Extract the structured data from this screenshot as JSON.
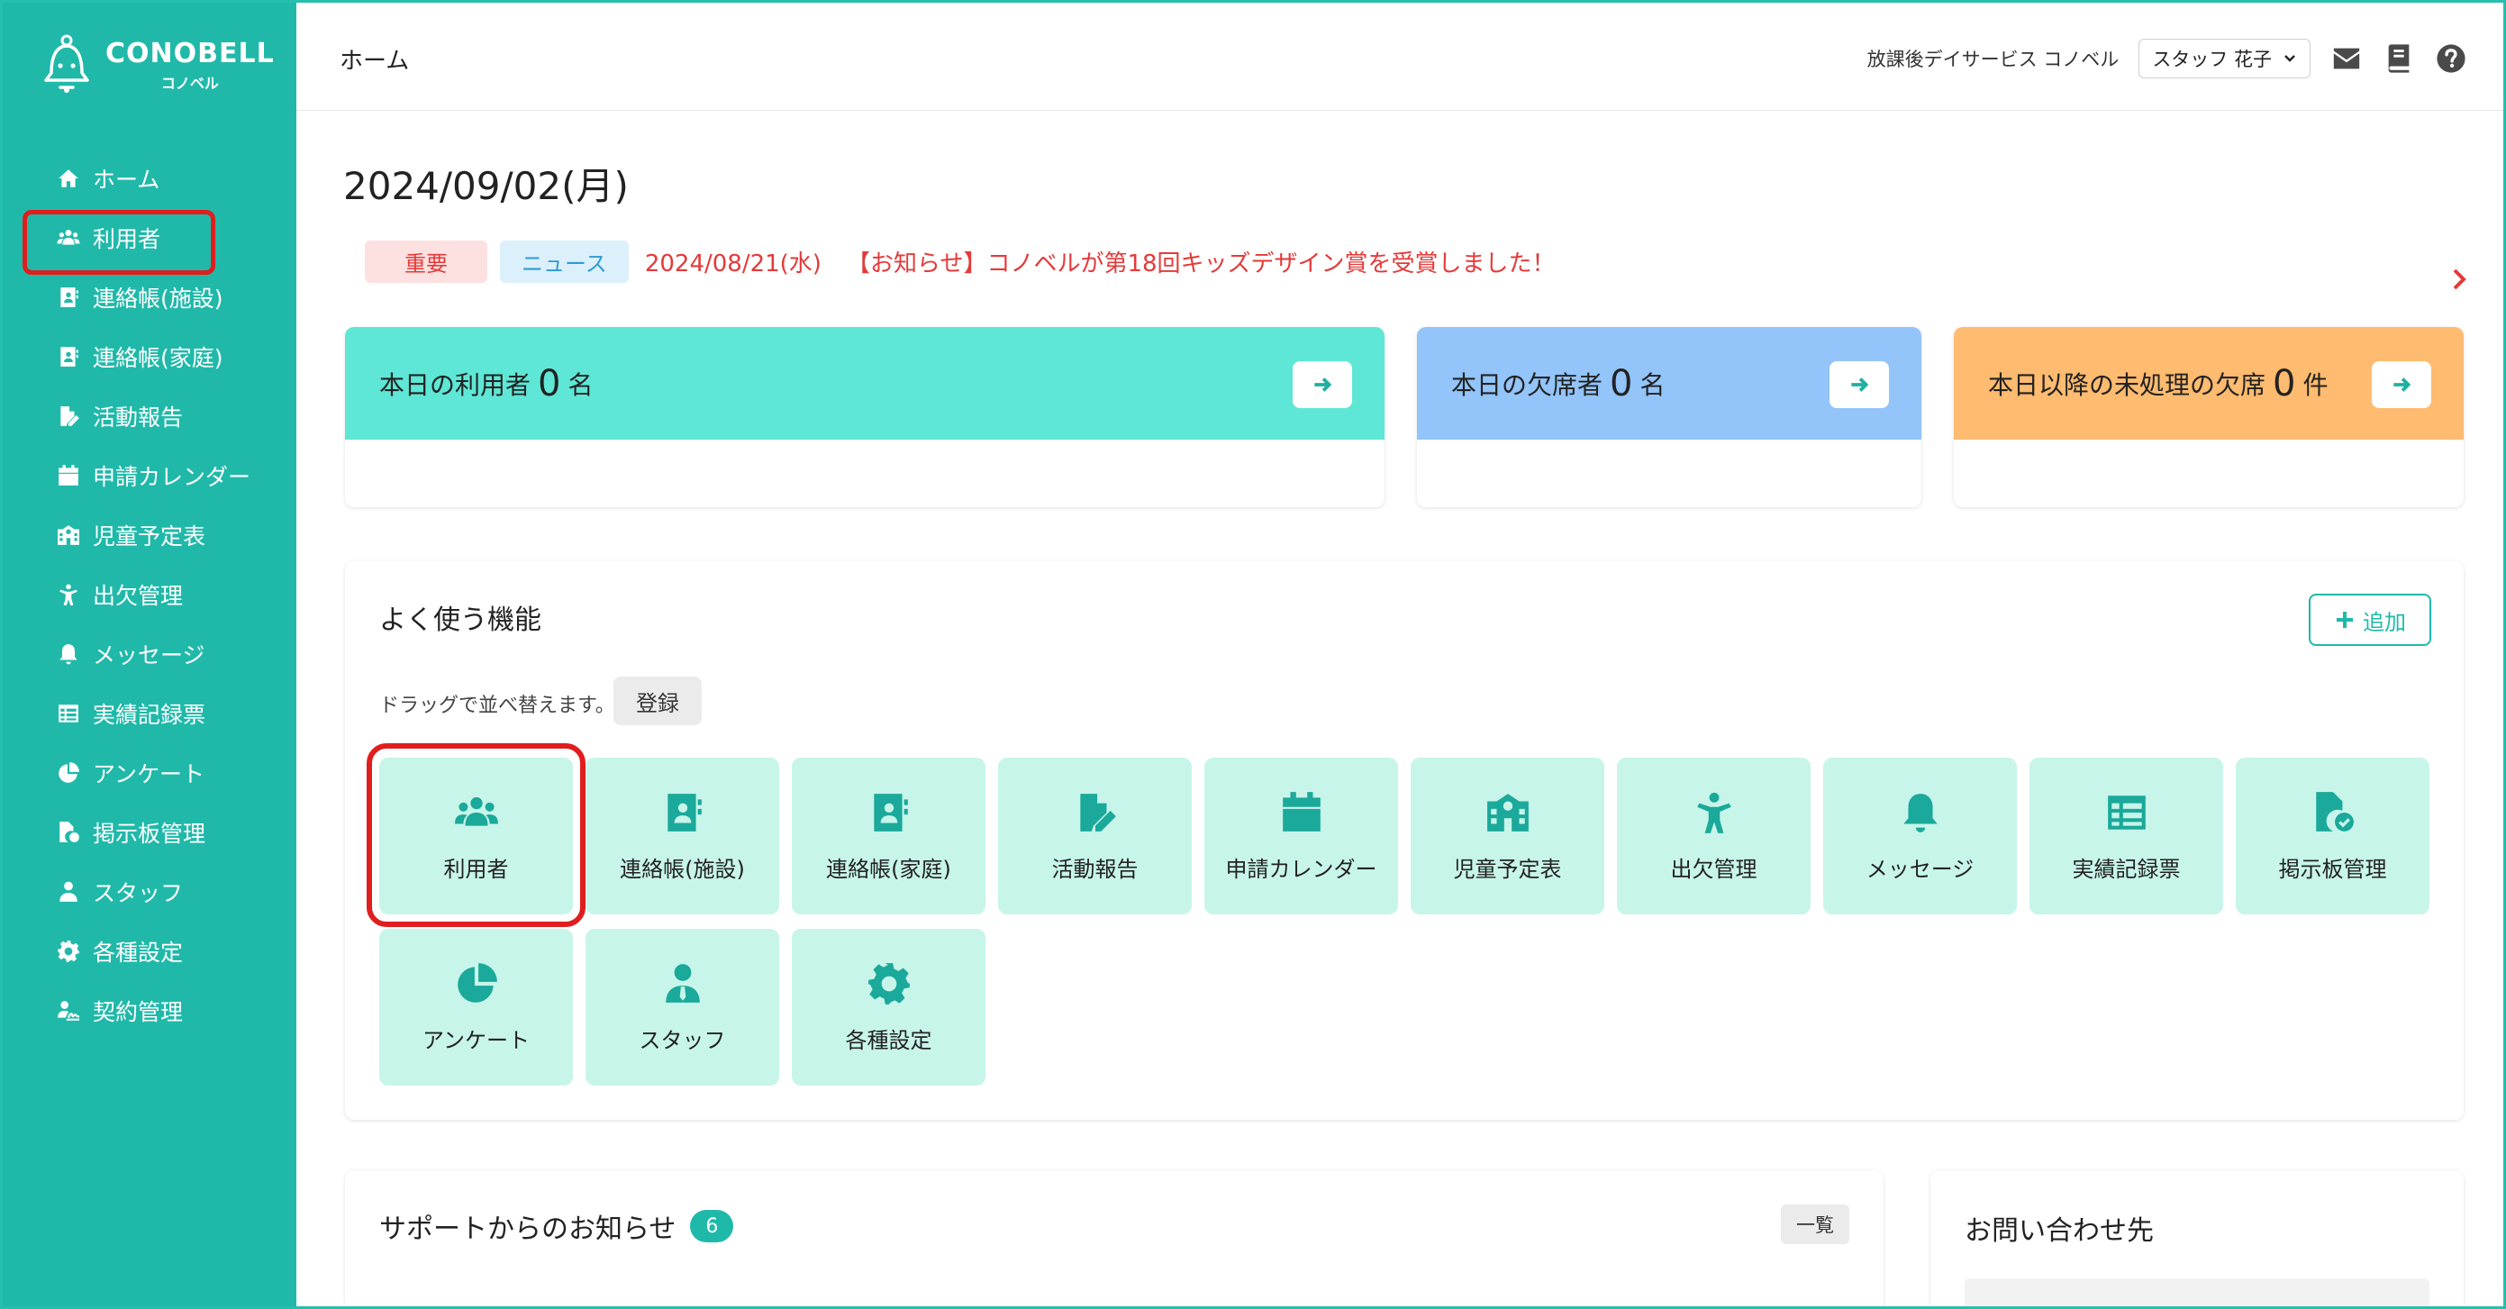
{
  "brand": {
    "name": "CONOBELL",
    "sub": "コノベル"
  },
  "sidebar": {
    "items": [
      {
        "label": "ホーム",
        "icon": "home-icon"
      },
      {
        "label": "利用者",
        "icon": "users-icon"
      },
      {
        "label": "連絡帳(施設)",
        "icon": "contact-book-icon"
      },
      {
        "label": "連絡帳(家庭)",
        "icon": "contact-book-icon"
      },
      {
        "label": "活動報告",
        "icon": "report-icon"
      },
      {
        "label": "申請カレンダー",
        "icon": "calendar-icon"
      },
      {
        "label": "児童予定表",
        "icon": "school-icon"
      },
      {
        "label": "出欠管理",
        "icon": "attendance-icon"
      },
      {
        "label": "メッセージ",
        "icon": "bell-icon"
      },
      {
        "label": "実績記録票",
        "icon": "table-icon"
      },
      {
        "label": "アンケート",
        "icon": "pie-chart-icon"
      },
      {
        "label": "掲示板管理",
        "icon": "board-icon"
      },
      {
        "label": "スタッフ",
        "icon": "staff-icon"
      },
      {
        "label": "各種設定",
        "icon": "gear-icon"
      },
      {
        "label": "契約管理",
        "icon": "contract-icon"
      }
    ]
  },
  "header": {
    "breadcrumb": "ホーム",
    "facility": "放課後デイサービス コノベル",
    "user": "スタッフ 花子"
  },
  "main": {
    "date": "2024/09/02(月)",
    "news": {
      "tag_important": "重要",
      "tag_news": "ニュース",
      "date": "2024/08/21(水)",
      "text": "【お知らせ】コノベルが第18回キッズデザイン賞を受賞しました！"
    },
    "stats": [
      {
        "prefix": "本日の利用者",
        "value": "0",
        "unit": "名",
        "color": "#5ee7d6"
      },
      {
        "prefix": "本日の欠席者",
        "value": "0",
        "unit": "名",
        "color": "#93c4fa"
      },
      {
        "prefix": "本日以降の未処理の欠席",
        "value": "0",
        "unit": "件",
        "color": "#ffbb6f"
      }
    ],
    "favorites": {
      "title": "よく使う機能",
      "add_label": "追加",
      "hint": "ドラッグで並べ替えます。",
      "register_label": "登録",
      "tiles": [
        {
          "label": "利用者",
          "icon": "users-icon"
        },
        {
          "label": "連絡帳(施設)",
          "icon": "contact-book-icon"
        },
        {
          "label": "連絡帳(家庭)",
          "icon": "contact-book-icon"
        },
        {
          "label": "活動報告",
          "icon": "report-icon"
        },
        {
          "label": "申請カレンダー",
          "icon": "calendar-icon"
        },
        {
          "label": "児童予定表",
          "icon": "school-icon"
        },
        {
          "label": "出欠管理",
          "icon": "attendance-icon"
        },
        {
          "label": "メッセージ",
          "icon": "bell-icon"
        },
        {
          "label": "実績記録票",
          "icon": "table-icon"
        },
        {
          "label": "掲示板管理",
          "icon": "board-icon"
        },
        {
          "label": "アンケート",
          "icon": "pie-chart-icon"
        },
        {
          "label": "スタッフ",
          "icon": "staff-icon"
        },
        {
          "label": "各種設定",
          "icon": "gear-icon"
        }
      ]
    },
    "support": {
      "title": "サポートからのお知らせ",
      "count": "6",
      "list_label": "一覧"
    },
    "contact": {
      "title": "お問い合わせ先"
    }
  },
  "colors": {
    "sidebar": "#20b9a9",
    "accent": "#1fb9a9",
    "tile": "#c8f5ea",
    "highlight": "#e01e1e",
    "alert": "#e43a3a"
  }
}
